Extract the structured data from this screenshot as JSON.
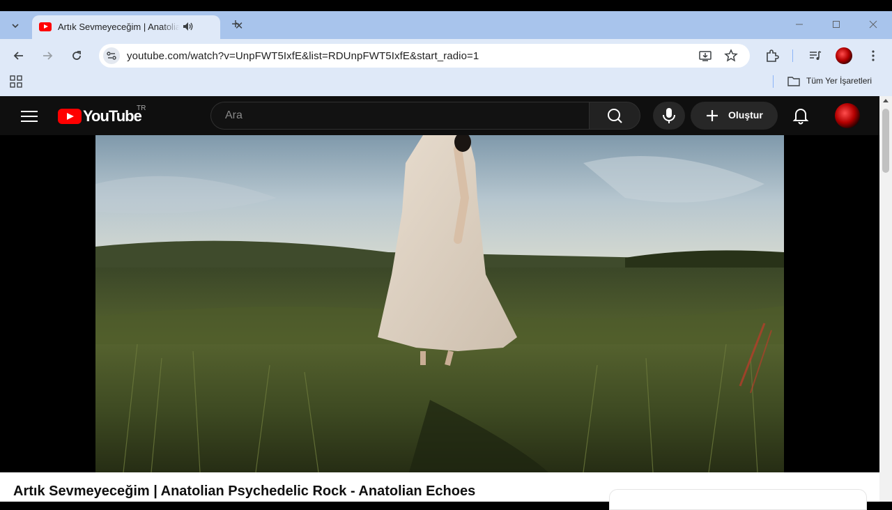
{
  "browser": {
    "tab": {
      "title": "Artık Sevmeyeceğim | Anatolian Psychedelic Rock - Anatolian Echoes",
      "close_glyph": "✕",
      "audio_icon": "speaker-icon",
      "favicon": "youtube-favicon"
    },
    "new_tab_glyph": "+",
    "tab_list_glyph": "⌄",
    "window_controls": {
      "minimize": "—",
      "maximize": "☐",
      "close": "✕"
    },
    "nav": {
      "back": "←",
      "forward": "→",
      "reload": "↻"
    },
    "url": "youtube.com/watch?v=UnpFWT5IxfE&list=RDUnpFWT5IxfE&start_radio=1",
    "bookmarks": {
      "all_bookmarks_label": "Tüm Yer İşaretleri"
    }
  },
  "youtube": {
    "logo_text": "YouTube",
    "country_code": "TR",
    "search": {
      "placeholder": "Ara"
    },
    "create_label": "Oluştur"
  },
  "video": {
    "title": "Artık Sevmeyeceğim | Anatolian Psychedelic Rock - Anatolian Echoes"
  },
  "colors": {
    "yt_red": "#ff0000",
    "yt_dark": "#0f0f0f",
    "chrome_tabbar": "#a8c4ec",
    "chrome_toolbar": "#dfe9f8"
  }
}
